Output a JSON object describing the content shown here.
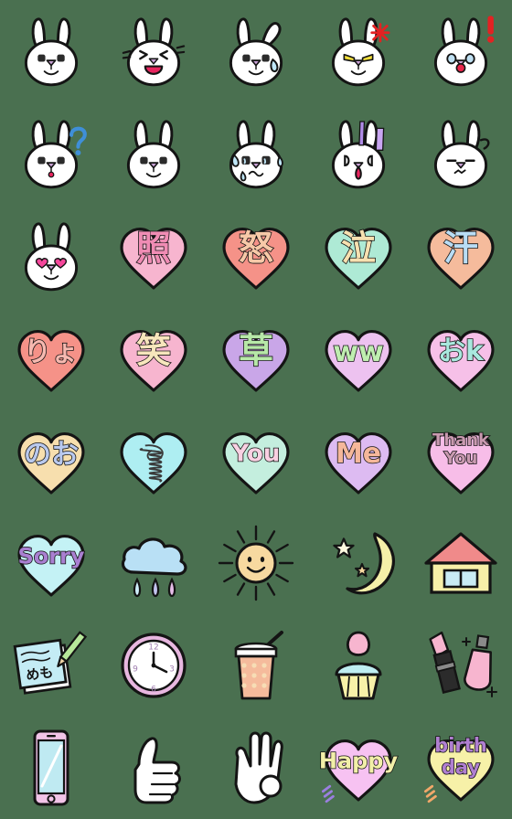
{
  "sheet": {
    "title": "Rabbit & Pastel Heart Emoji Sheet",
    "background_color": "#4a7050",
    "columns": 5,
    "rows": 8,
    "cell_size_px": 112
  },
  "palette": {
    "outline": "#141414",
    "white": "#ffffff",
    "pink_heart": "#f7b5cf",
    "pink_heart_light": "#f9c3d8",
    "salmon_heart": "#f59288",
    "mint_heart": "#aeead5",
    "peach_heart": "#f5bb9c",
    "lavender_heart": "#c9a6e8",
    "lilac_heart": "#edc2f0",
    "cream_heart": "#f7dfae",
    "cyan_heart": "#aeeef2",
    "yellow_heart": "#f7f1a8",
    "magenta": "#e8255f",
    "red": "#e32222",
    "purple_text": "#a97fd1",
    "blue_text": "#9fc7ee",
    "mint_text": "#a9e8c8",
    "cream_text": "#f7e0b0",
    "peach_text": "#f5b79a",
    "mauve_text": "#c99ab0",
    "yellow_text": "#f2efa8",
    "sky": "#b9e0f5",
    "sun_yellow": "#f7d9a0",
    "moon_yellow": "#f5f0a8",
    "roof_red": "#f08a8a",
    "house_body": "#f7f0a8"
  },
  "items": [
    {
      "id": 1,
      "name": "rabbit-neutral",
      "kind": "rabbit",
      "label": "neutral rabbit face",
      "text": ""
    },
    {
      "id": 2,
      "name": "rabbit-laughing",
      "kind": "rabbit",
      "label": "laughing rabbit face",
      "text": ""
    },
    {
      "id": 3,
      "name": "rabbit-sad-teardrop",
      "kind": "rabbit",
      "label": "sad rabbit with teardrop, drooping ear",
      "text": ""
    },
    {
      "id": 4,
      "name": "rabbit-angry",
      "kind": "rabbit",
      "label": "angry rabbit with anger mark",
      "text": ""
    },
    {
      "id": 5,
      "name": "rabbit-surprised",
      "kind": "rabbit",
      "label": "surprised rabbit with exclamation mark",
      "text": ""
    },
    {
      "id": 6,
      "name": "rabbit-confused",
      "kind": "rabbit",
      "label": "confused rabbit with question mark",
      "text": ""
    },
    {
      "id": 7,
      "name": "rabbit-calm",
      "kind": "rabbit",
      "label": "calm rabbit face",
      "text": ""
    },
    {
      "id": 8,
      "name": "rabbit-crying",
      "kind": "rabbit",
      "label": "crying rabbit with sweat drops",
      "text": ""
    },
    {
      "id": 9,
      "name": "rabbit-shocked",
      "kind": "rabbit",
      "label": "shocked rabbit with purple shock lines",
      "text": ""
    },
    {
      "id": 10,
      "name": "rabbit-annoyed",
      "kind": "rabbit",
      "label": "annoyed rabbit with flat eyes",
      "text": ""
    },
    {
      "id": 11,
      "name": "rabbit-heart-eyes",
      "kind": "rabbit",
      "label": "rabbit with pink heart eyes",
      "text": ""
    },
    {
      "id": 12,
      "name": "heart-shy",
      "kind": "heart",
      "label": "shy",
      "text": "照",
      "heart_color": "#f7b5cf",
      "text_color": "#f08cb4",
      "font_size": 38,
      "text_dy": -2
    },
    {
      "id": 13,
      "name": "heart-angry",
      "kind": "heart",
      "label": "anger",
      "text": "怒",
      "heart_color": "#f59288",
      "text_color": "#f7c9a8",
      "font_size": 38,
      "text_dy": -2
    },
    {
      "id": 14,
      "name": "heart-cry",
      "kind": "heart",
      "label": "cry",
      "text": "泣",
      "heart_color": "#aeead5",
      "text_color": "#f7e0b0",
      "font_size": 38,
      "text_dy": -2
    },
    {
      "id": 15,
      "name": "heart-sweat",
      "kind": "heart",
      "label": "sweat",
      "text": "汗",
      "heart_color": "#f5bb9c",
      "text_color": "#b9ddf5",
      "font_size": 38,
      "text_dy": -2
    },
    {
      "id": 16,
      "name": "heart-ryo",
      "kind": "heart",
      "label": "roger (ryo)",
      "text": "りょ",
      "heart_color": "#f59288",
      "text_color": "#f7b9b0",
      "font_size": 30,
      "text_dy": 0
    },
    {
      "id": 17,
      "name": "heart-laugh",
      "kind": "heart",
      "label": "laugh",
      "text": "笑",
      "heart_color": "#f7b5cf",
      "text_color": "#f7e6bc",
      "font_size": 38,
      "text_dy": -2
    },
    {
      "id": 18,
      "name": "heart-grass",
      "kind": "heart",
      "label": "grass (lol)",
      "text": "草",
      "heart_color": "#c9a6e8",
      "text_color": "#b7e8a8",
      "font_size": 38,
      "text_dy": -2
    },
    {
      "id": 19,
      "name": "heart-ww",
      "kind": "heart",
      "label": "ww",
      "text": "ww",
      "heart_color": "#edc2f0",
      "text_color": "#bfeeb0",
      "font_size": 30,
      "text_dy": 0
    },
    {
      "id": 20,
      "name": "heart-ok",
      "kind": "heart",
      "label": "ok",
      "text": "おk",
      "heart_color": "#f6c0e8",
      "text_color": "#a9e8de",
      "font_size": 30,
      "text_dy": -1
    },
    {
      "id": 21,
      "name": "heart-nooo",
      "kind": "heart",
      "label": "no",
      "text": "のお",
      "heart_color": "#f7dfae",
      "text_color": "#b9c9ee",
      "font_size": 30,
      "text_dy": 0
    },
    {
      "id": 22,
      "name": "heart-scribble",
      "kind": "scribble",
      "label": "scribble",
      "heart_color": "#aeeef2",
      "text": ""
    },
    {
      "id": 23,
      "name": "heart-you",
      "kind": "heart",
      "label": "You",
      "text": "You",
      "heart_color": "#c4eede",
      "text_color": "#f9d0e2",
      "font_size": 26,
      "text_dy": -1
    },
    {
      "id": 24,
      "name": "heart-me",
      "kind": "heart",
      "label": "Me",
      "text": "Me",
      "heart_color": "#ddbbf2",
      "text_color": "#f5b79a",
      "font_size": 30,
      "text_dy": -1
    },
    {
      "id": 25,
      "name": "heart-thank-you",
      "kind": "heart",
      "label": "Thank You",
      "text": "Thank\nYou",
      "heart_color": "#f7bde8",
      "text_color": "#c99ab0",
      "font_size": 18,
      "text_dy": -6
    },
    {
      "id": 26,
      "name": "heart-sorry",
      "kind": "heart",
      "label": "Sorry",
      "text": "Sorry",
      "heart_color": "#c4f2f5",
      "text_color": "#a97fd1",
      "font_size": 24,
      "text_dy": -1
    },
    {
      "id": 27,
      "name": "rain-cloud",
      "kind": "cloud",
      "label": "rain cloud",
      "text": ""
    },
    {
      "id": 28,
      "name": "sun-smiling",
      "kind": "sun",
      "label": "smiling sun",
      "text": ""
    },
    {
      "id": 29,
      "name": "moon-stars",
      "kind": "moon",
      "label": "crescent moon with stars",
      "text": ""
    },
    {
      "id": 30,
      "name": "house",
      "kind": "house",
      "label": "house",
      "text": ""
    },
    {
      "id": 31,
      "name": "memo-pad",
      "kind": "memo",
      "label": "memo pad with pencil",
      "text": "めも"
    },
    {
      "id": 32,
      "name": "wall-clock",
      "kind": "clock",
      "label": "wall clock",
      "text": ""
    },
    {
      "id": 33,
      "name": "drink-cup",
      "kind": "drink",
      "label": "iced drink with straw",
      "text": ""
    },
    {
      "id": 34,
      "name": "cupcake",
      "kind": "cupcake",
      "label": "cupcake",
      "text": ""
    },
    {
      "id": 35,
      "name": "cosmetics",
      "kind": "cosmetics",
      "label": "lipstick and nail polish",
      "text": ""
    },
    {
      "id": 36,
      "name": "smartphone",
      "kind": "phone",
      "label": "smartphone",
      "text": ""
    },
    {
      "id": 37,
      "name": "thumbs-up-hand",
      "kind": "thumb",
      "label": "thumbs up",
      "text": ""
    },
    {
      "id": 38,
      "name": "ok-hand",
      "kind": "okhand",
      "label": "ok hand sign",
      "text": ""
    },
    {
      "id": 39,
      "name": "heart-happy",
      "kind": "heart",
      "label": "Happy",
      "text": "Happy",
      "heart_color": "#f7c2f2",
      "text_color": "#f2efa8",
      "font_size": 24,
      "text_dy": -1,
      "sparkle": "#9b7fe0"
    },
    {
      "id": 40,
      "name": "heart-birthday",
      "kind": "heart",
      "label": "birth day",
      "text": "birth\nday",
      "heart_color": "#f7f1a8",
      "text_color": "#b07fd1",
      "font_size": 21,
      "text_dy": -6,
      "sparkle": "#f2a86a"
    }
  ]
}
